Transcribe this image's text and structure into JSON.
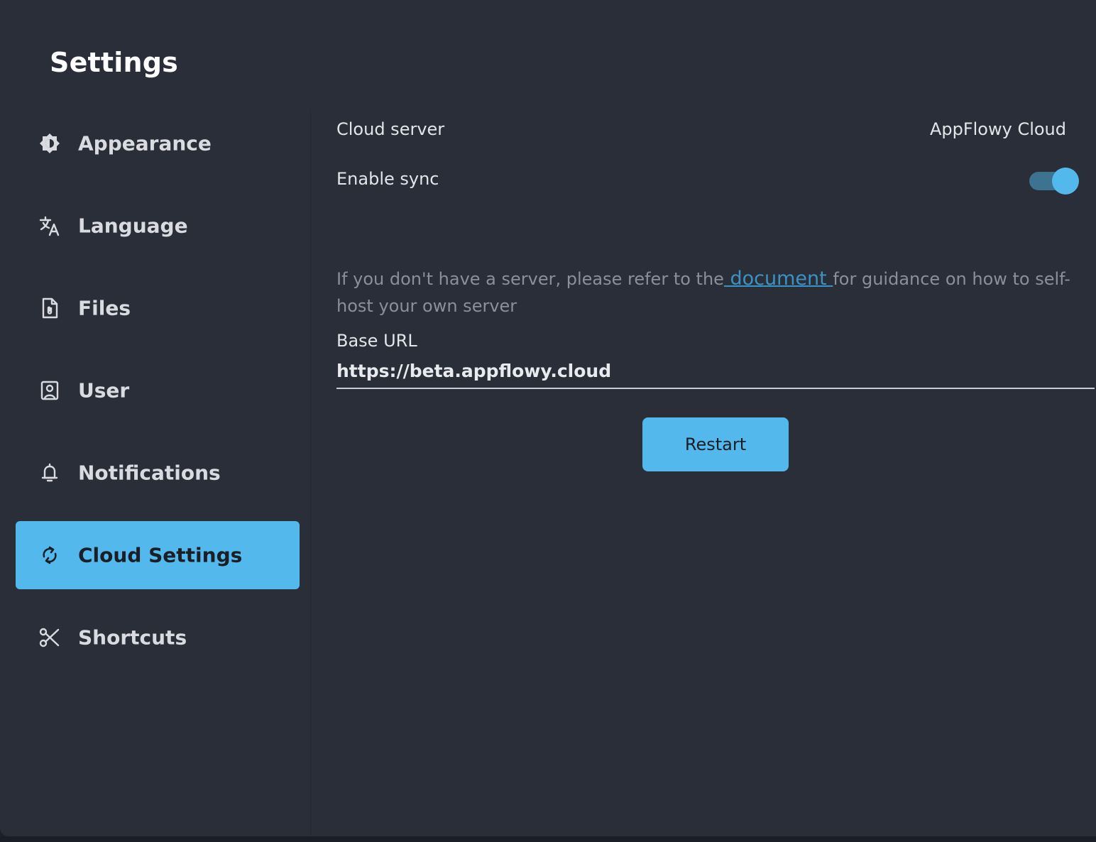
{
  "dialog": {
    "title": "Settings"
  },
  "sidebar": {
    "items": [
      {
        "id": "appearance",
        "label": "Appearance",
        "icon": "appearance-icon",
        "active": false
      },
      {
        "id": "language",
        "label": "Language",
        "icon": "language-icon",
        "active": false
      },
      {
        "id": "files",
        "label": "Files",
        "icon": "file-icon",
        "active": false
      },
      {
        "id": "user",
        "label": "User",
        "icon": "user-icon",
        "active": false
      },
      {
        "id": "notifications",
        "label": "Notifications",
        "icon": "bell-icon",
        "active": false
      },
      {
        "id": "cloud-settings",
        "label": "Cloud Settings",
        "icon": "sync-icon",
        "active": true
      },
      {
        "id": "shortcuts",
        "label": "Shortcuts",
        "icon": "scissors-icon",
        "active": false
      }
    ]
  },
  "cloud": {
    "server_label": "Cloud server",
    "server_value": "AppFlowy Cloud",
    "sync_label": "Enable sync",
    "sync_enabled": true,
    "help_prefix": "If you don't have a server, please refer to the",
    "help_link": " document ",
    "help_suffix": "for guidance on how to self-host your own server",
    "base_url_label": "Base URL",
    "base_url_value": "https://beta.appflowy.cloud",
    "restart_label": "Restart"
  },
  "colors": {
    "accent": "#53b9ec",
    "background": "#2a2e39",
    "link": "#3a93c2"
  }
}
